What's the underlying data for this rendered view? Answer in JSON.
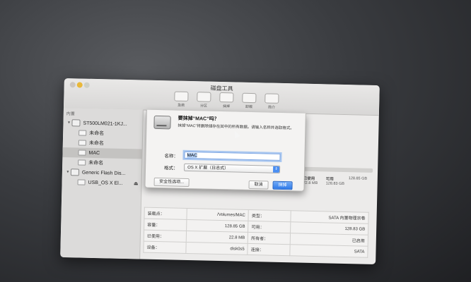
{
  "window": {
    "title": "磁盘工具"
  },
  "toolbar": [
    {
      "label": "急救"
    },
    {
      "label": "分区"
    },
    {
      "label": "抹掉"
    },
    {
      "label": "卸载"
    },
    {
      "label": "简介"
    }
  ],
  "sidebar": {
    "header": "内置",
    "items": [
      {
        "label": "ST500LM021-1KJ...",
        "kind": "disk"
      },
      {
        "label": "未命名",
        "kind": "volume"
      },
      {
        "label": "未命名",
        "kind": "volume"
      },
      {
        "label": "MAC",
        "kind": "volume",
        "selected": true
      },
      {
        "label": "未命名",
        "kind": "volume"
      },
      {
        "label": "Generic Flash Dis...",
        "kind": "disk"
      },
      {
        "label": "USB_OS X El...",
        "kind": "volume",
        "eject": "⏏"
      }
    ]
  },
  "usage": {
    "stats": [
      {
        "label": "已使用",
        "value": "22.8 MB"
      },
      {
        "label": "可用",
        "value": "128.83 GB"
      },
      {
        "label": "",
        "value": "128.85 GB"
      }
    ]
  },
  "info_table": [
    {
      "k1": "装载点：",
      "v1": "/Volumes/MAC",
      "k2": "类型：",
      "v2": "SATA 内置物理宗卷"
    },
    {
      "k1": "容量：",
      "v1": "128.85 GB",
      "k2": "可用：",
      "v2": "128.83 GB"
    },
    {
      "k1": "已使用：",
      "v1": "22.8 MB",
      "k2": "所有者：",
      "v2": "已启用"
    },
    {
      "k1": "设备：",
      "v1": "disk0s5",
      "k2": "连接：",
      "v2": "SATA"
    }
  ],
  "dialog": {
    "title": "要抹掉“MAC”吗？",
    "description": "抹掉“MAC”将删除储存在其中的所有数据。请输入名称并选取格式。",
    "name_label": "名称：",
    "name_value": "MAC",
    "format_label": "格式：",
    "format_value": "OS X 扩展（日志式）",
    "security_button": "安全性选项...",
    "cancel_button": "取消",
    "erase_button": "抹掉"
  },
  "colors": {
    "accent": "#2f7ae8",
    "window_bg": "#ecebea"
  }
}
